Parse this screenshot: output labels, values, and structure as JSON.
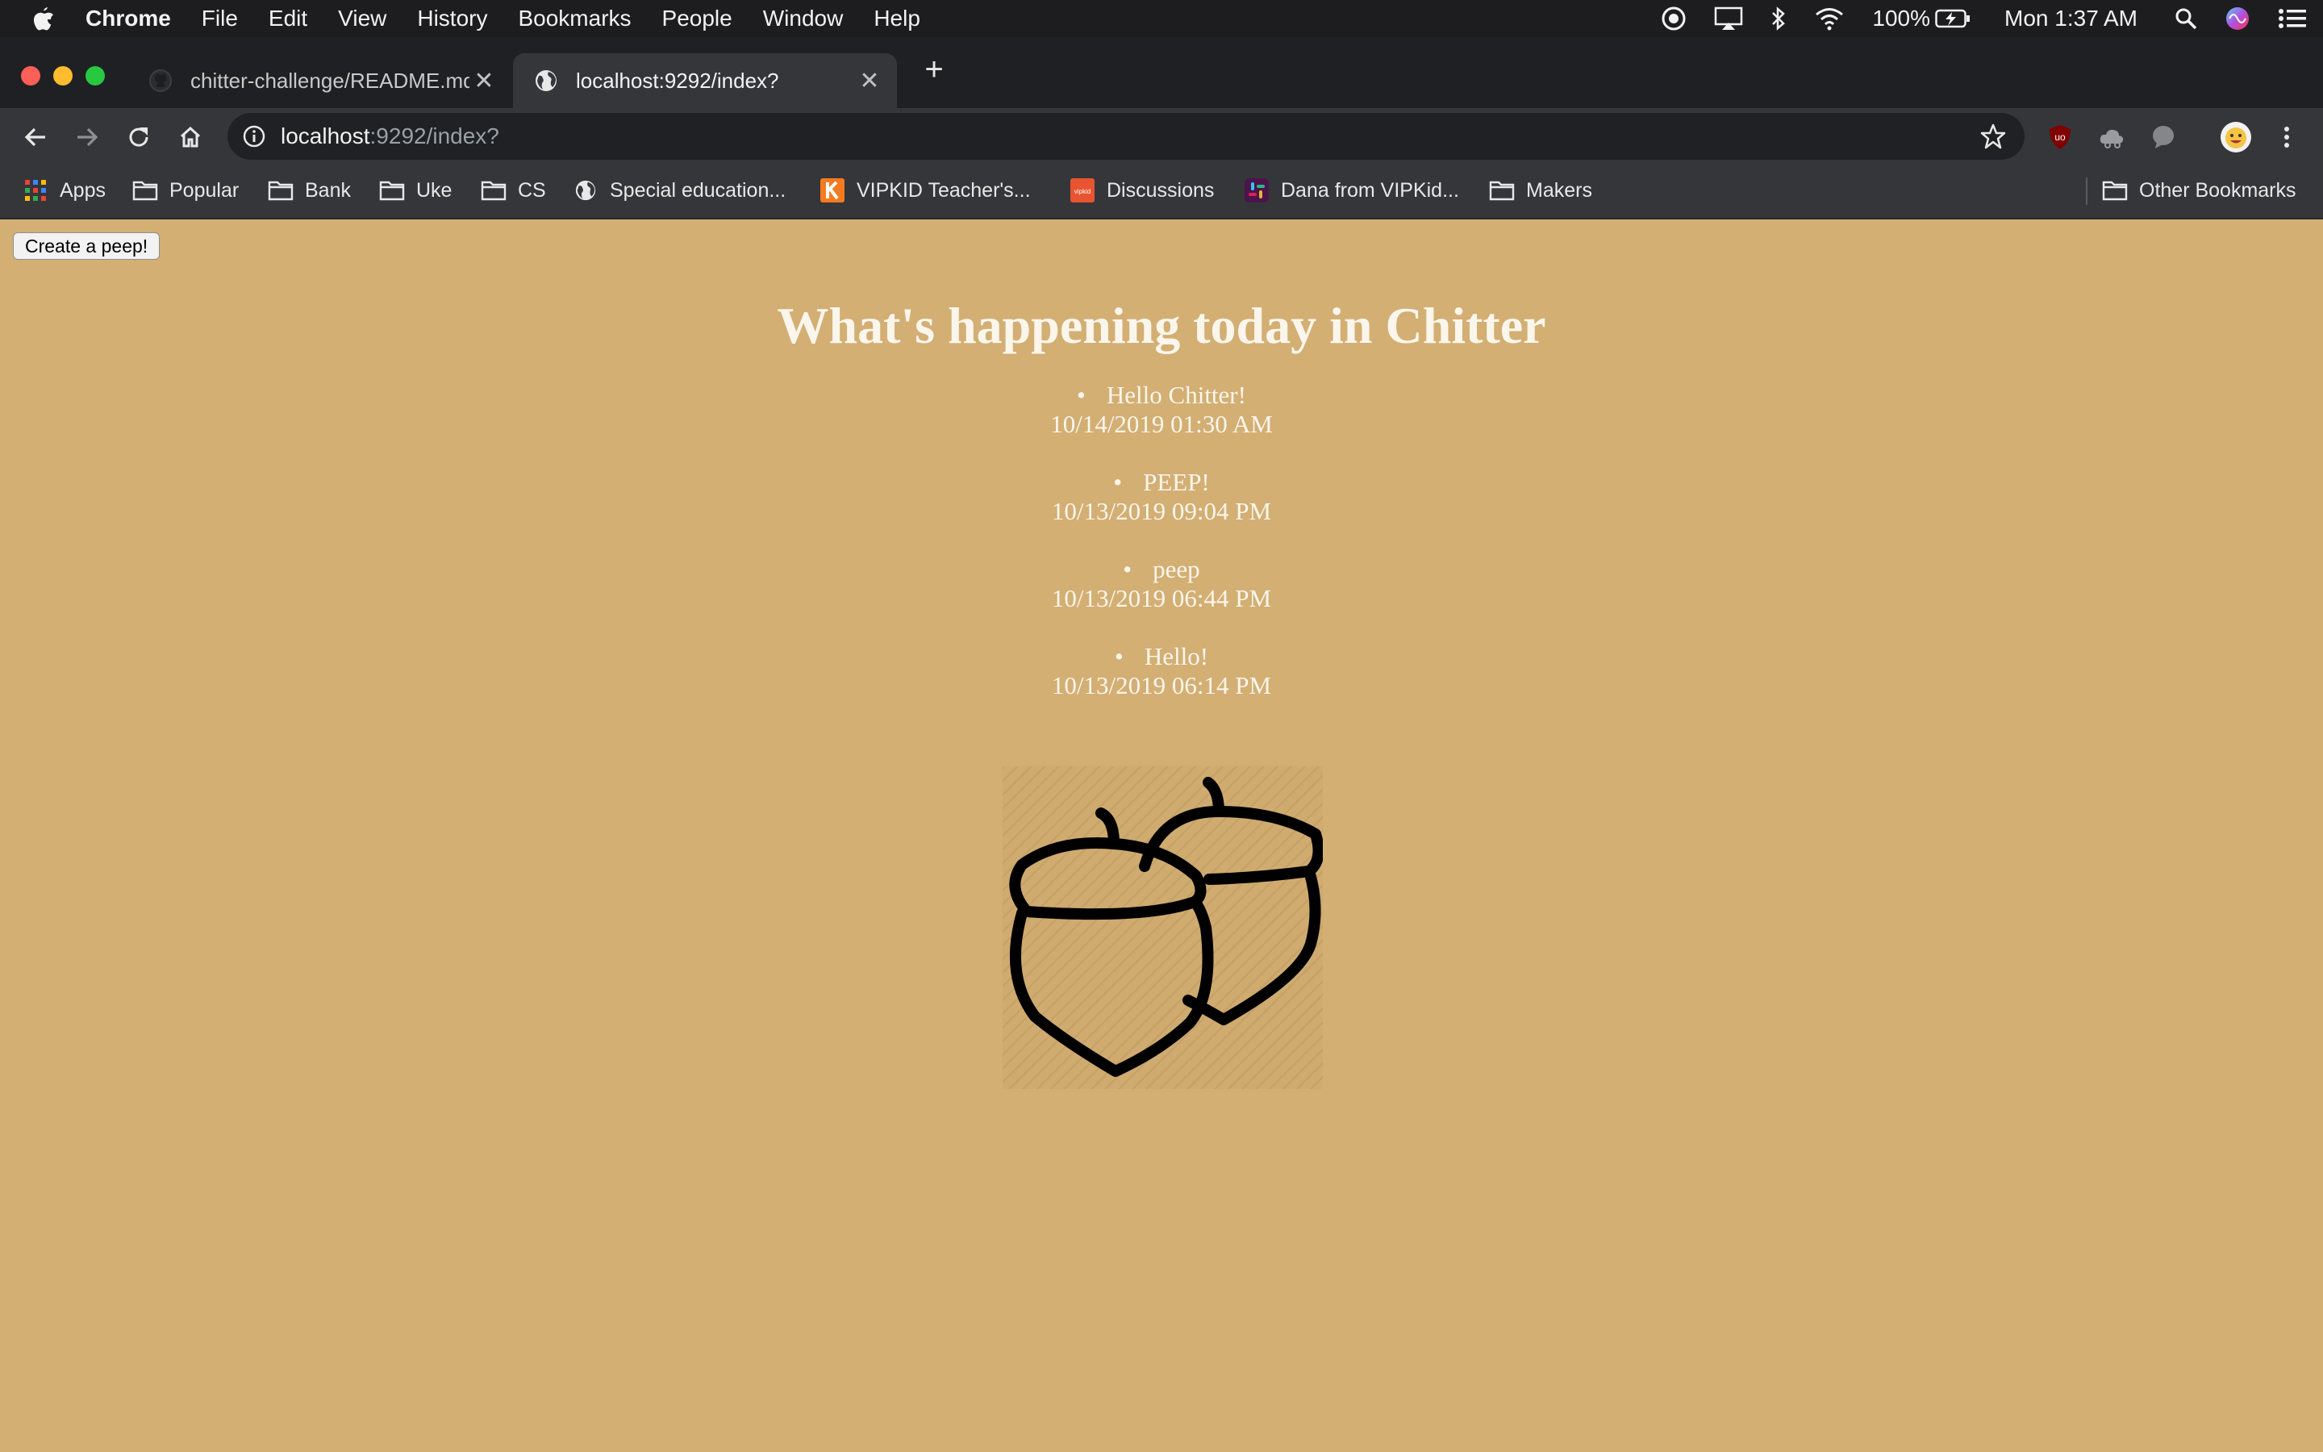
{
  "menubar": {
    "app_name": "Chrome",
    "items": [
      "File",
      "Edit",
      "View",
      "History",
      "Bookmarks",
      "People",
      "Window",
      "Help"
    ],
    "battery": "100%",
    "clock": "Mon 1:37 AM"
  },
  "tabs": [
    {
      "title": "chitter-challenge/README.md",
      "icon": "github-icon",
      "active": false
    },
    {
      "title": "localhost:9292/index?",
      "icon": "globe-icon",
      "active": true
    }
  ],
  "omnibox": {
    "host": "localhost",
    "path": ":9292/index?"
  },
  "bookmarks": {
    "items": [
      {
        "label": "Apps",
        "icon": "apps-grid-icon"
      },
      {
        "label": "Popular",
        "icon": "folder-icon"
      },
      {
        "label": "Bank",
        "icon": "folder-icon"
      },
      {
        "label": "Uke",
        "icon": "folder-icon"
      },
      {
        "label": "CS",
        "icon": "folder-icon"
      },
      {
        "label": "Special education...",
        "icon": "globe-icon"
      },
      {
        "label": "VIPKID Teacher's...",
        "icon": "vipkid-icon"
      },
      {
        "label": "Discussions",
        "icon": "discussions-icon"
      },
      {
        "label": "Dana from VIPKid...",
        "icon": "slack-icon"
      },
      {
        "label": "Makers",
        "icon": "folder-icon"
      }
    ],
    "other": "Other Bookmarks"
  },
  "page": {
    "create_button": "Create a peep!",
    "heading": "What's happening today in Chitter",
    "peeps": [
      {
        "text": "Hello Chitter!",
        "time": "10/14/2019 01:30 AM"
      },
      {
        "text": "PEEP!",
        "time": "10/13/2019 09:04 PM"
      },
      {
        "text": "peep",
        "time": "10/13/2019 06:44 PM"
      },
      {
        "text": "Hello!",
        "time": "10/13/2019 06:14 PM"
      }
    ]
  },
  "colors": {
    "page_background": "#d3af74",
    "heading_text": "#fbf6ec",
    "toolbar": "#35363a",
    "tabstrip": "#1f2023"
  }
}
